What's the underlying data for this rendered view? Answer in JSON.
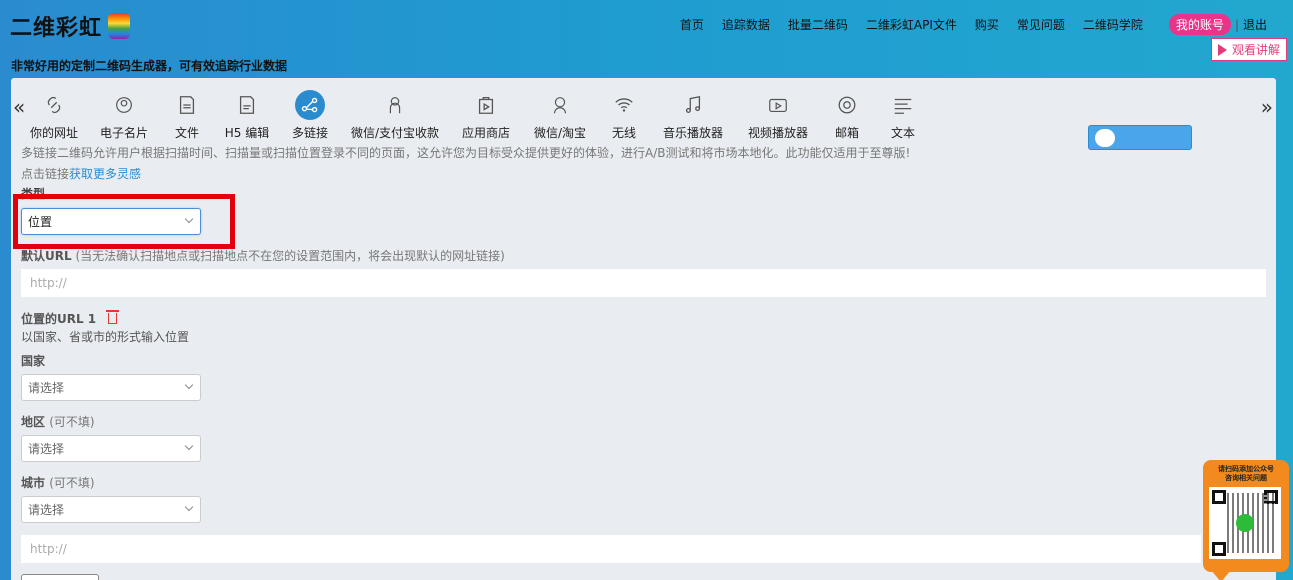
{
  "header": {
    "logo_text": "二维彩虹",
    "tagline": "非常好用的定制二维码生成器，可有效追踪行业数据",
    "nav": [
      "首页",
      "追踪数据",
      "批量二维码",
      "二维彩虹API文件",
      "购买",
      "常见问题",
      "二维码学院"
    ],
    "account": "我的账号",
    "separator": "|",
    "logout": "退出",
    "watch": "观看讲解"
  },
  "tabs": [
    {
      "label": "你的网址",
      "icon": "link-icon"
    },
    {
      "label": "电子名片",
      "icon": "user-card-icon"
    },
    {
      "label": "文件",
      "icon": "pdf-file-icon"
    },
    {
      "label": "H5 编辑",
      "icon": "html-file-icon"
    },
    {
      "label": "多链接",
      "icon": "share-icon",
      "active": true
    },
    {
      "label": "微信/支付宝收款",
      "icon": "payment-icon"
    },
    {
      "label": "应用商店",
      "icon": "app-store-icon"
    },
    {
      "label": "微信/淘宝",
      "icon": "wechat-taobao-icon"
    },
    {
      "label": "无线",
      "icon": "wifi-icon"
    },
    {
      "label": "音乐播放器",
      "icon": "music-icon"
    },
    {
      "label": "视频播放器",
      "icon": "video-icon"
    },
    {
      "label": "邮箱",
      "icon": "email-icon"
    },
    {
      "label": "文本",
      "icon": "text-icon"
    }
  ],
  "description": "多链接二维码允许用户根据扫描时间、扫描量或扫描位置登录不同的页面，这允许您为目标受众提供更好的体验，进行A/B测试和将市场本地化。此功能仅适用于至尊版!",
  "link_prefix": "点击链接",
  "link_text": "获取更多灵感",
  "type": {
    "label": "类型",
    "value": "位置"
  },
  "default_url": {
    "label": "默认URL",
    "note": "(当无法确认扫描地点或扫描地点不在您的设置范围内，将会出现默认的网址链接)",
    "placeholder": "http://"
  },
  "location": {
    "title": "位置的URL 1",
    "hint": "以国家、省或市的形式输入位置",
    "country_label": "国家",
    "region_label": "地区",
    "city_label": "城市",
    "optional": "(可不填)",
    "select_placeholder": "请选择",
    "url_placeholder": "http://"
  },
  "qr_widget": {
    "line1": "请扫码添加公众号",
    "line2": "咨询相关问题"
  },
  "colors": {
    "accent": "#2a8ccf",
    "account": "#e8358a",
    "highlight": "#e3000e",
    "widget": "#f28a1d"
  }
}
